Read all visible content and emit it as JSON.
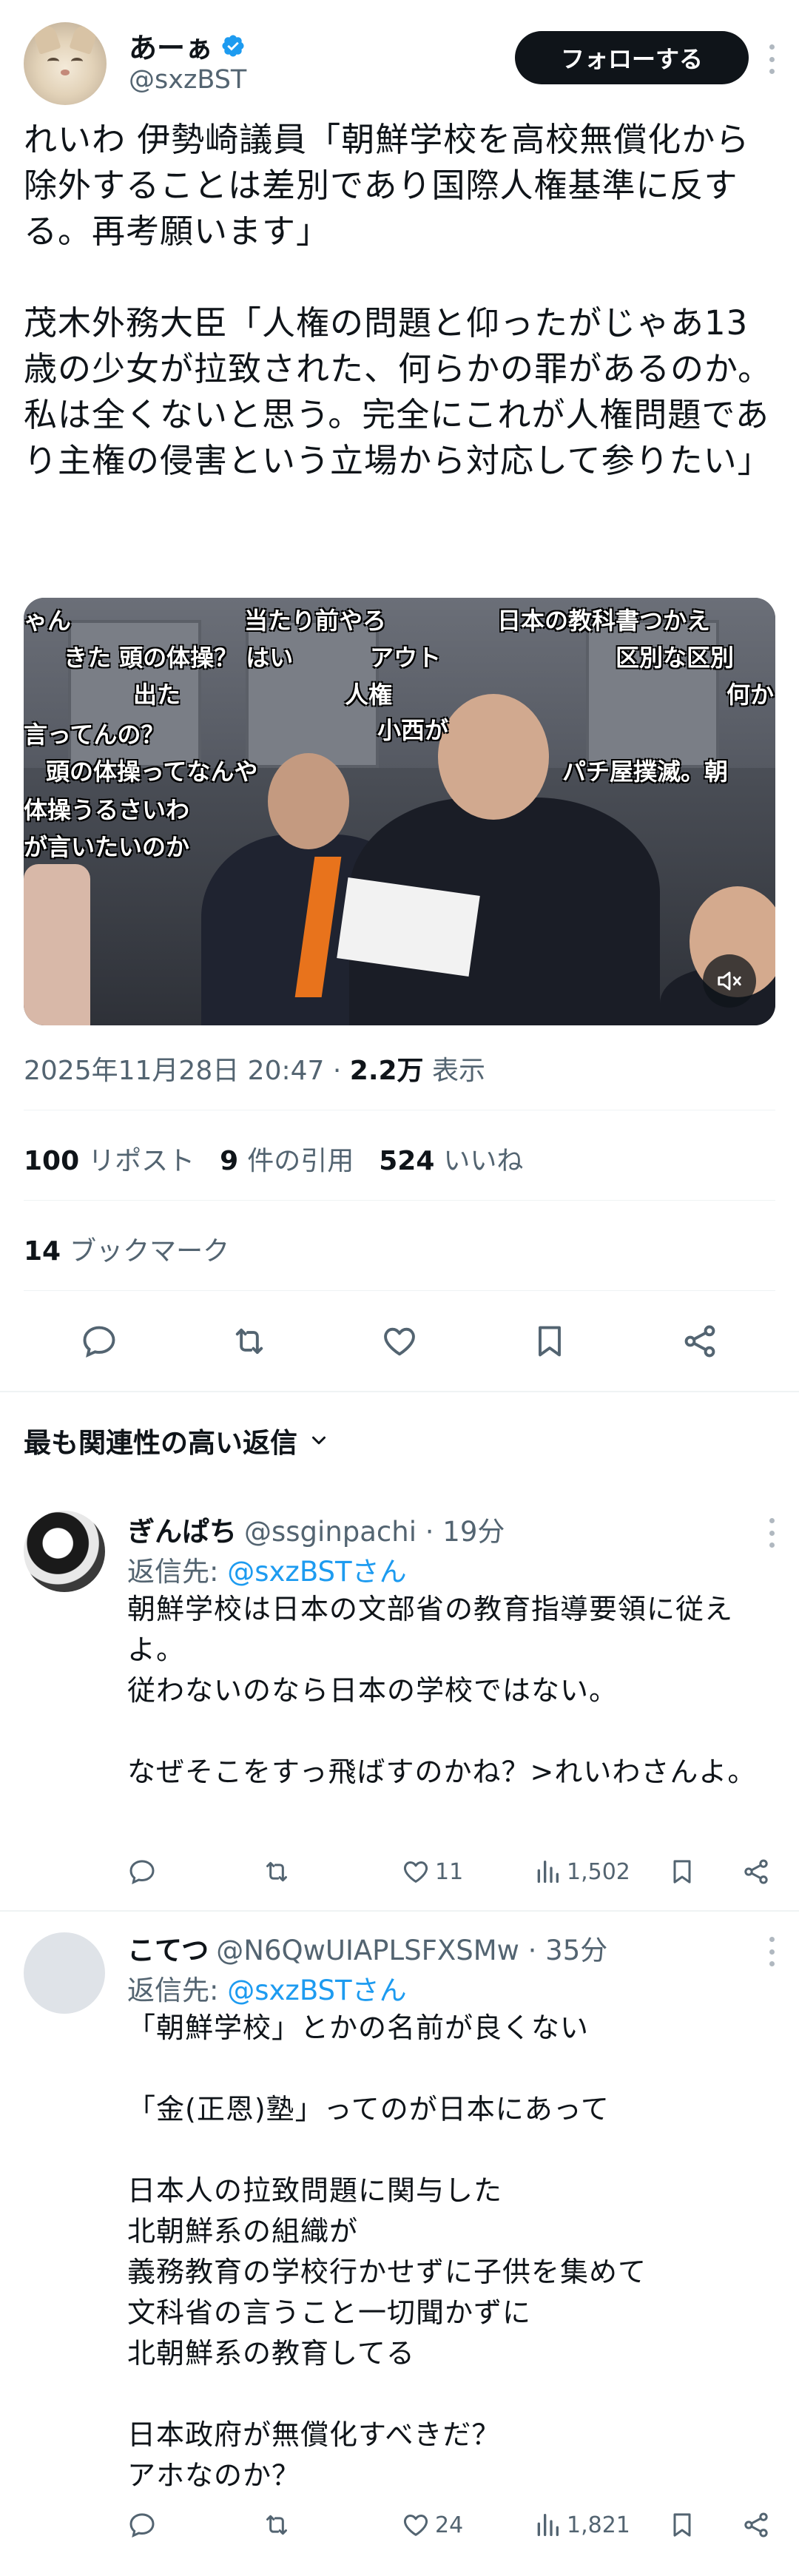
{
  "tweet": {
    "display_name": "あーぁ",
    "handle": "@sxzBST",
    "follow_label": "フォローする",
    "text": "れいわ 伊勢崎議員「朝鮮学校を高校無償化から除外することは差別であり国際人権基準に反する。再考願います」\n\n茂木外務大臣「人権の問題と仰ったがじゃあ13歳の少女が拉致された、何らかの罪があるのか。私は全くないと思う。完全にこれが人権問題であり主権の侵害という立場から対応して参りたい」",
    "video_overlay": [
      "ゃん",
      "当たり前やろ",
      "日本の教科書つかえ",
      "きた 頭の体操？ はい",
      "アウト",
      "区別な区別",
      "人権",
      "出た",
      "何か",
      "小西が",
      "言ってんの？",
      "頭の体操ってなんや",
      "パチ屋撲滅。朝",
      "体操うるさいわ",
      "が言いたいのか"
    ],
    "timestamp": "2025年11月28日 20:47",
    "views_count": "2.2万",
    "views_label": "表示",
    "reposts_count": "100",
    "reposts_label": "リポスト",
    "quotes_count": "9",
    "quotes_label": "件の引用",
    "likes_count": "524",
    "likes_label": "いいね",
    "bookmarks_count": "14",
    "bookmarks_label": "ブックマーク"
  },
  "sort_label": "最も関連性の高い返信",
  "replies": [
    {
      "display_name": "ぎんぱち",
      "handle_time": "@ssginpachi · 19分",
      "reply_to_label": "返信先: ",
      "reply_to_handle": "@sxzBSTさん",
      "text": "朝鮮学校は日本の文部省の教育指導要領に従えよ。\n従わないのなら日本の学校ではない。\n\nなぜそこをすっ飛ばすのかね？>れいわさんよ。",
      "likes": "11",
      "views": "1,502"
    },
    {
      "display_name": "こてつ",
      "handle_time": "@N6QwUIAPLSFXSMw · 35分",
      "reply_to_label": "返信先: ",
      "reply_to_handle": "@sxzBSTさん",
      "text": "「朝鮮学校」とかの名前が良くない\n\n「金(正恩)塾」ってのが日本にあって\n\n日本人の拉致問題に関与した\n北朝鮮系の組織が\n義務教育の学校行かせずに子供を集めて\n文科省の言うこと一切聞かずに\n北朝鮮系の教育してる\n\n日本政府が無償化すべきだ？\nアホなのか？",
      "likes": "24",
      "views": "1,821"
    }
  ],
  "colors": {
    "accent": "#1d9bf0",
    "text_primary": "#0f1419",
    "text_secondary": "#536471",
    "follow_button_bg": "#0f1419"
  },
  "icons": {
    "verified": "verified-badge-icon",
    "reply": "reply-icon",
    "repost": "repost-icon",
    "like": "heart-icon",
    "bookmark": "bookmark-icon",
    "share": "share-icon",
    "views": "bar-chart-icon",
    "mute": "volume-mute-icon"
  }
}
